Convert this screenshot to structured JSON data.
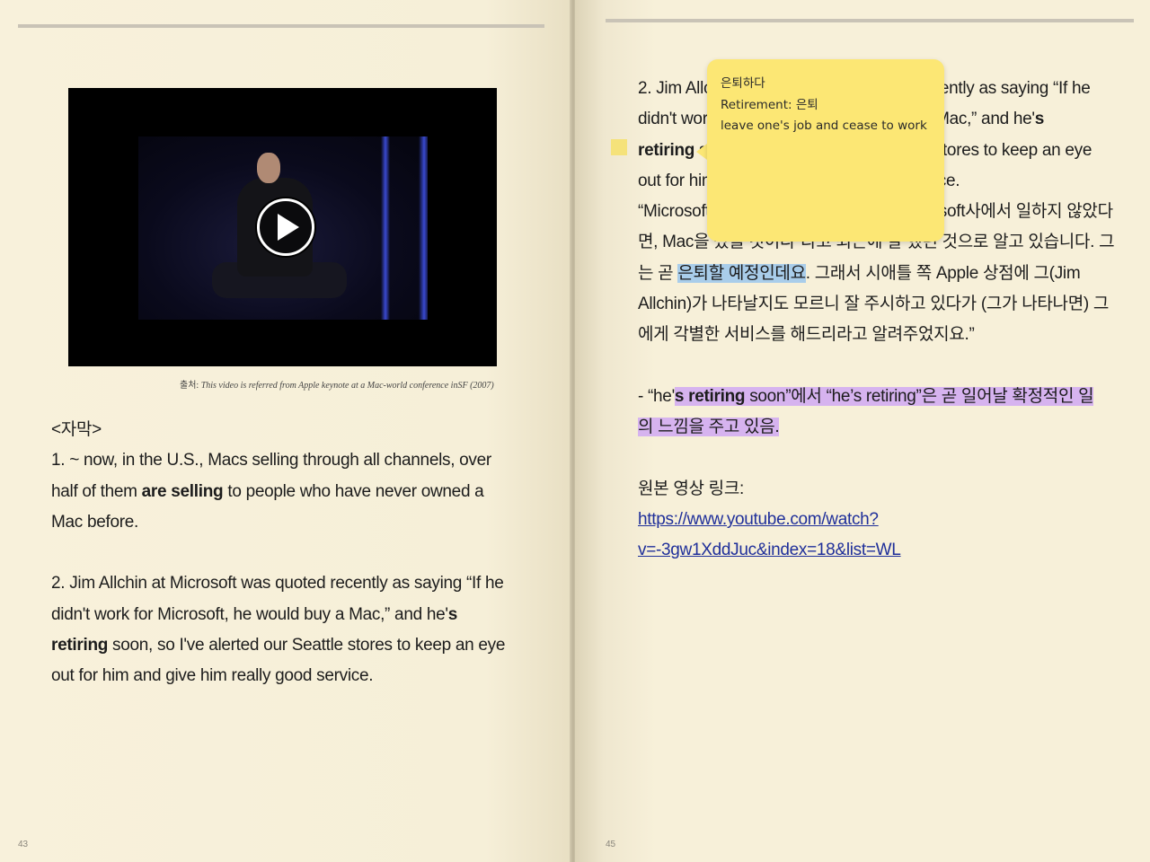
{
  "left_page": {
    "page_number": "43",
    "video": {
      "label": "Apple keynote video",
      "play_icon": "play-icon"
    },
    "caption": {
      "prefix": "출처:",
      "text": "This video is referred from Apple keynote at a Mac-world conference inSF (2007)"
    },
    "subtitle_heading": "<자막>",
    "item1": {
      "a": "1. ~ now, in the U.S., Macs selling through all channels, over",
      "b": "half of them ",
      "b_bold": "are selling",
      "c": " to people who have never owned a",
      "d": "Mac before."
    },
    "item2": {
      "a": "2. Jim Allchin at Microsoft was quoted recently as saying “If he",
      "b": "didn't work for Microsoft, he would buy a Mac,” and he'",
      "b_bold": "s",
      "c_bold": "retiring",
      "c": " soon, so I've alerted our Seattle stores to keep an eye",
      "d": "out for him and give him really good service."
    }
  },
  "right_page": {
    "page_number": "45",
    "item2": {
      "l1": "2. Jim Allchin at Microsoft was quoted recently as saying “If he",
      "l2a": "didn't work for Microsoft, he would buy a Mac,” and he'",
      "l2_bold": "s",
      "l3_bold": "retiring",
      "l3": " soon, so I've alerted our Seattle stores to keep an eye",
      "l4": "out for him and give him really good service.",
      "l5": "“Microsoft의 Jim Allchin은 만약 그가 Microsoft사에서 일하지 않았다",
      "l6": "면, Mac을 샀을 것이다”라고 최근에 말 했던 것으로 알고 있습니다. 그",
      "l7a": "는 곧 ",
      "l7_hl": "은퇴할 예정인데요",
      "l7b": ". 그래서 시애틀 쪽 Apple 상점에 그(Jim",
      "l8": "Allchin)가 나타날지도 모르니 잘 주시하고 있다가 (그가 나타나면) 그",
      "l9": "에게 각별한 서비스를 해드리라고 알려주었지요.”"
    },
    "note": {
      "a": "- “he'",
      "a_bold": "s retiring",
      "b": " soon”에서  “he’s retiring”은 곧 일어날 확정적인 일",
      "c": "의 느낌을 주고 있음."
    },
    "link_label": "원본 영상 링크:",
    "link_line1": "https://www.youtube.com/watch?",
    "link_line2": "v=-3gw1XddJuc&index=18&list=WL",
    "popup": {
      "word": "은퇴하다",
      "definition": "Retirement: 은퇴",
      "meaning": "leave one's job and cease to work"
    }
  },
  "colors": {
    "page": "#f7f0d9",
    "note_yellow": "#fce774",
    "highlight_blue": "#a9cdea",
    "highlight_purple": "#d6b3ef",
    "link": "#1f2f9a"
  }
}
